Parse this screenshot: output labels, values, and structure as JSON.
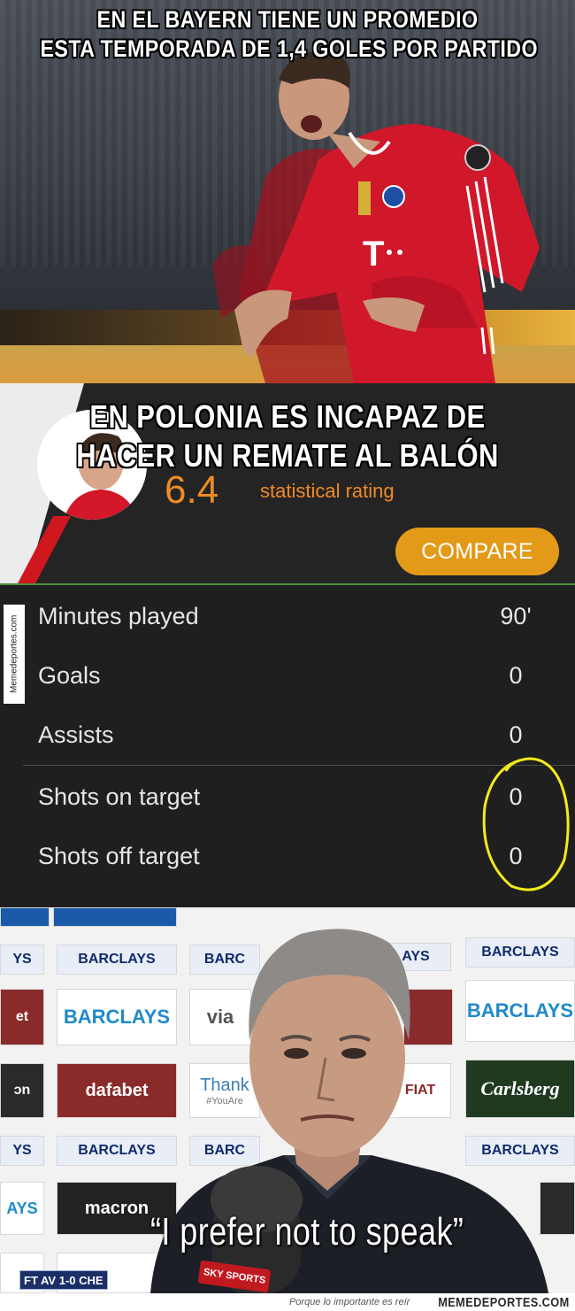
{
  "panel1": {
    "caption_lines": [
      "EN EL BAYERN TIENE UN PROMEDIO",
      "ESTA TEMPORADA DE 1,4 GOLES POR PARTIDO"
    ]
  },
  "panel2": {
    "caption_lines": [
      "EN POLONIA ES INCAPAZ DE",
      "HACER UN REMATE AL BALÓN"
    ],
    "rating_value": "6.4",
    "rating_label": "statistical rating",
    "compare_label": "COMPARE",
    "side_watermark": "Memedeportes.com",
    "stats": [
      {
        "label": "Minutes played",
        "value": "90'"
      },
      {
        "label": "Goals",
        "value": "0"
      },
      {
        "label": "Assists",
        "value": "0"
      },
      {
        "label": "Shots on target",
        "value": "0"
      },
      {
        "label": "Shots off target",
        "value": "0"
      }
    ],
    "circle_color": "#f2ea1a",
    "accent_color": "#f08a24",
    "button_color": "#e39a18"
  },
  "panel3": {
    "quote": "“I prefer not to speak”",
    "score_bug": "FT AV 1-0 CHE",
    "broadcaster": "SKY SPORTS",
    "sponsors": {
      "barclays": "BARCLAYS",
      "barclays_pl": "BARCLAYS",
      "dafabet": "dafabet",
      "carlsberg": "Carlsberg",
      "macron": "macron",
      "thank": "Thank",
      "thank_sub": "#YouAre",
      "via": "via",
      "barc": "BARC"
    }
  },
  "footer": {
    "tagline": "Porque lo importante es reír",
    "brand": "MEMEDEPORTES.COM"
  }
}
